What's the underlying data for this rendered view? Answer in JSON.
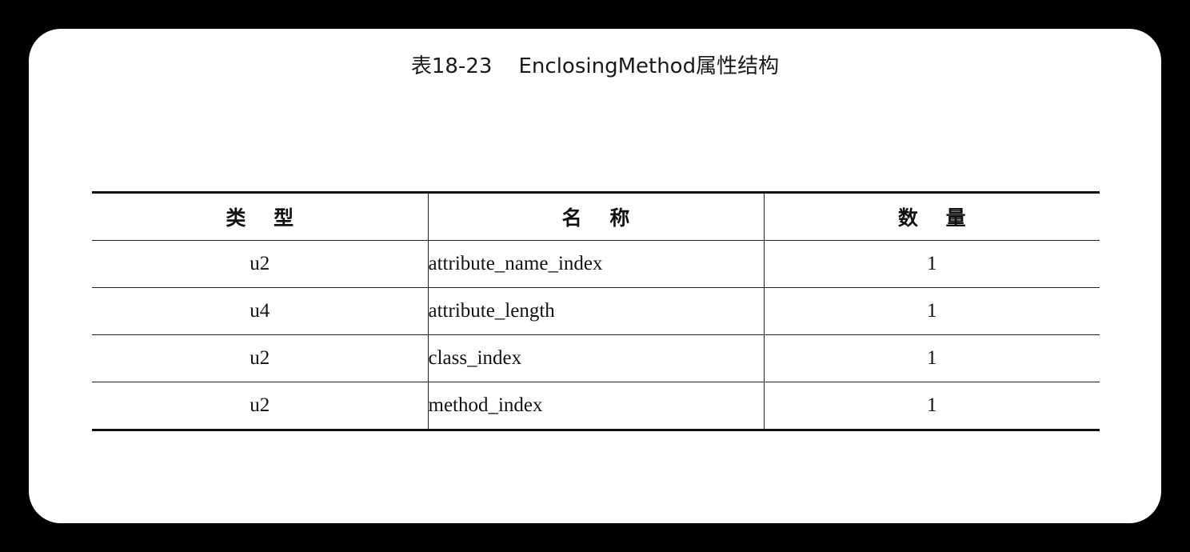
{
  "caption": "表18-23    EnclosingMethod属性结构",
  "table": {
    "headers": [
      "类    型",
      "名    称",
      "数    量"
    ],
    "rows": [
      {
        "type": "u2",
        "name": "attribute_name_index",
        "count": "1"
      },
      {
        "type": "u4",
        "name": "attribute_length",
        "count": "1"
      },
      {
        "type": "u2",
        "name": "class_index",
        "count": "1"
      },
      {
        "type": "u2",
        "name": "method_index",
        "count": "1"
      }
    ]
  }
}
